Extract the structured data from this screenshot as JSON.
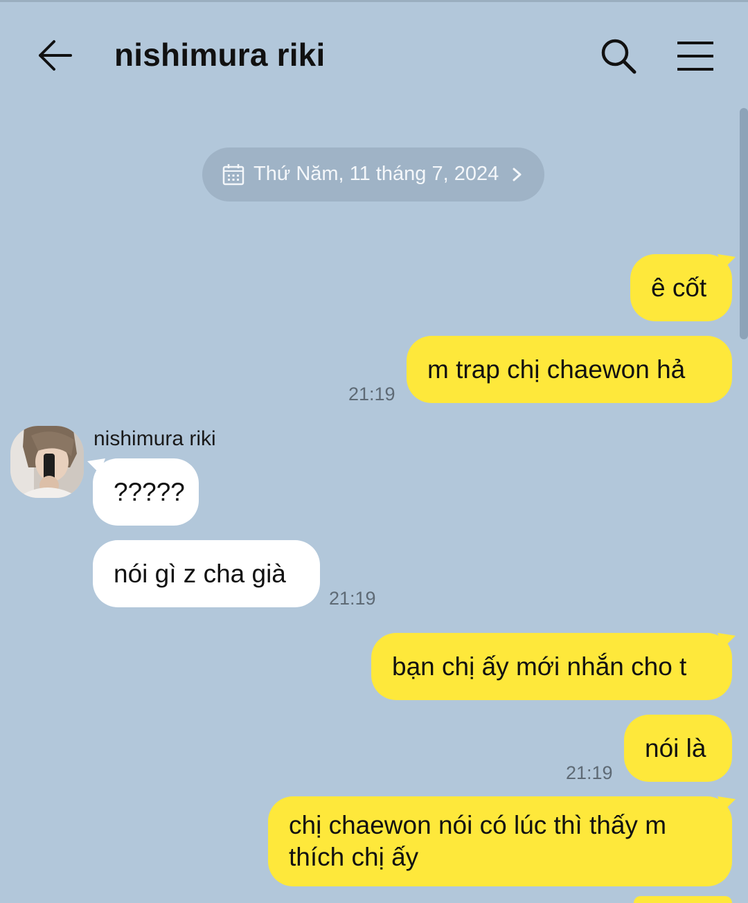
{
  "header": {
    "title": "nishimura riki"
  },
  "date_separator": "Thứ Năm, 11 tháng 7, 2024",
  "contact": {
    "name": "nishimura riki"
  },
  "messages": [
    {
      "from": "me",
      "text": "ê cốt"
    },
    {
      "from": "me",
      "text": "m trap chị chaewon hả",
      "time": "21:19"
    },
    {
      "from": "them",
      "text": "?????"
    },
    {
      "from": "them",
      "text": "nói gì z cha già",
      "time": "21:19"
    },
    {
      "from": "me",
      "text": "bạn chị ấy mới nhắn cho t"
    },
    {
      "from": "me",
      "text": "nói là",
      "time": "21:19"
    },
    {
      "from": "me",
      "text": "chị chaewon nói có lúc thì thấy m thích chị ấy"
    }
  ],
  "colors": {
    "background": "#b2c7da",
    "my_bubble": "#fee83b",
    "their_bubble": "#ffffff",
    "date_pill": "#9fb3c6"
  }
}
